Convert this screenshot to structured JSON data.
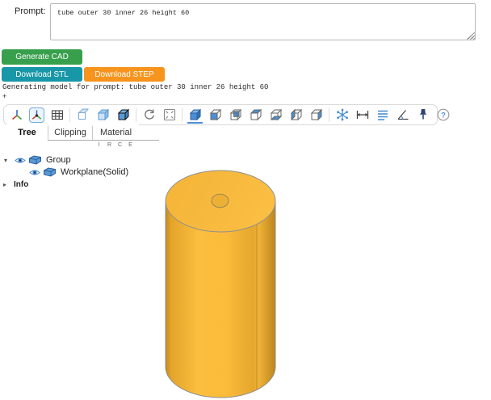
{
  "prompt": {
    "label": "Prompt:",
    "value": "tube outer 30 inner 26 height 60"
  },
  "buttons": {
    "generate": "Generate CAD",
    "download_stl": "Download STL",
    "download_step": "Download STEP"
  },
  "status": {
    "line1": "Generating model for prompt: tube outer 30 inner 26 height 60",
    "line2": "+"
  },
  "toolbar": {
    "icons": [
      "axes",
      "axes0",
      "grid",
      "ortho",
      "transparent",
      "black-edges",
      "reset-camera",
      "fit-view",
      "iso-view",
      "front-view",
      "rear-view",
      "top-view",
      "bottom-view",
      "left-view",
      "right-view",
      "explode",
      "distance-measure",
      "properties-measure",
      "angle-measure",
      "pin",
      "help"
    ]
  },
  "tabs": [
    {
      "label": "Tree",
      "active": true
    },
    {
      "label": "Clipping",
      "active": false
    },
    {
      "label": "Material",
      "active": false
    }
  ],
  "tree": {
    "header_letters": [
      "I",
      "R",
      "C",
      "E"
    ],
    "rows": [
      {
        "label": "Group"
      },
      {
        "label": "Workplane(Solid)"
      }
    ],
    "info_label": "Info"
  },
  "viewer": {
    "solid_color": "#f9bb3d",
    "solid_dark": "#c18a20",
    "edge_color": "#8f8f8f"
  },
  "colors": {
    "generate_green": "#38a04d",
    "stl_teal": "#1797a8",
    "step_orange": "#f7941e",
    "accent_blue": "#4a90d2"
  }
}
